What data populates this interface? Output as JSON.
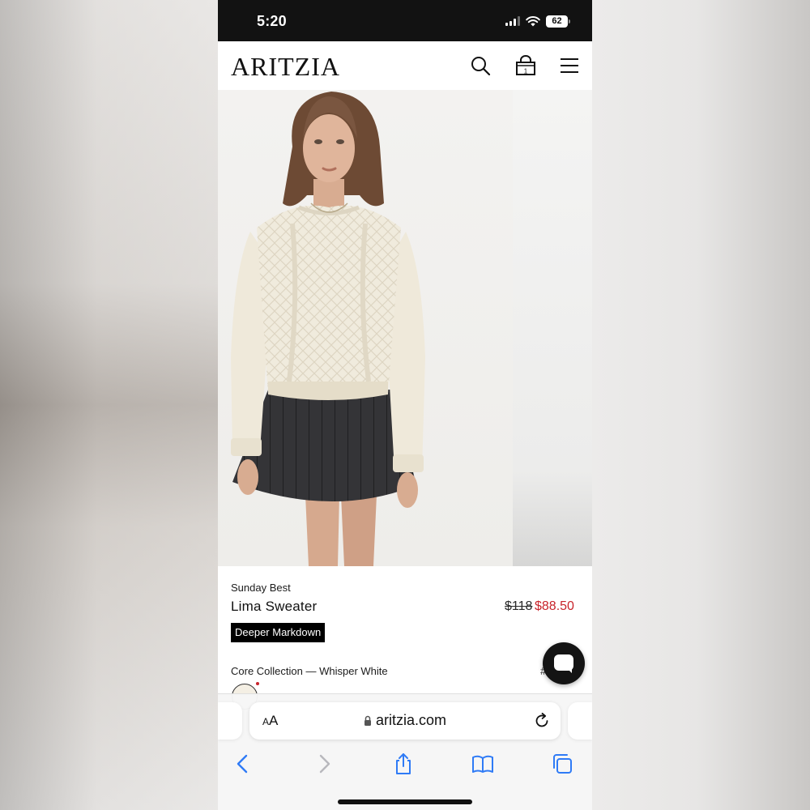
{
  "status_bar": {
    "time": "5:20",
    "battery": "62"
  },
  "header": {
    "logo": "ARITZIA",
    "icons": [
      "search-icon",
      "bag-icon",
      "menu-icon"
    ],
    "bag_count": "1"
  },
  "product": {
    "brand": "Sunday Best",
    "name": "Lima Sweater",
    "price_original": "$118",
    "price_sale": "$88.50",
    "badge": "Deeper Markdown",
    "collection": "Core Collection — Whisper White",
    "collection_extra": "#",
    "sale_color": "#c8242b"
  },
  "browser": {
    "text_size_label_big": "A",
    "text_size_label_small": "A",
    "url": "aritzia.com",
    "toolbar_icons": [
      "back-icon",
      "forward-icon",
      "share-icon",
      "bookmarks-icon",
      "tabs-icon"
    ]
  }
}
